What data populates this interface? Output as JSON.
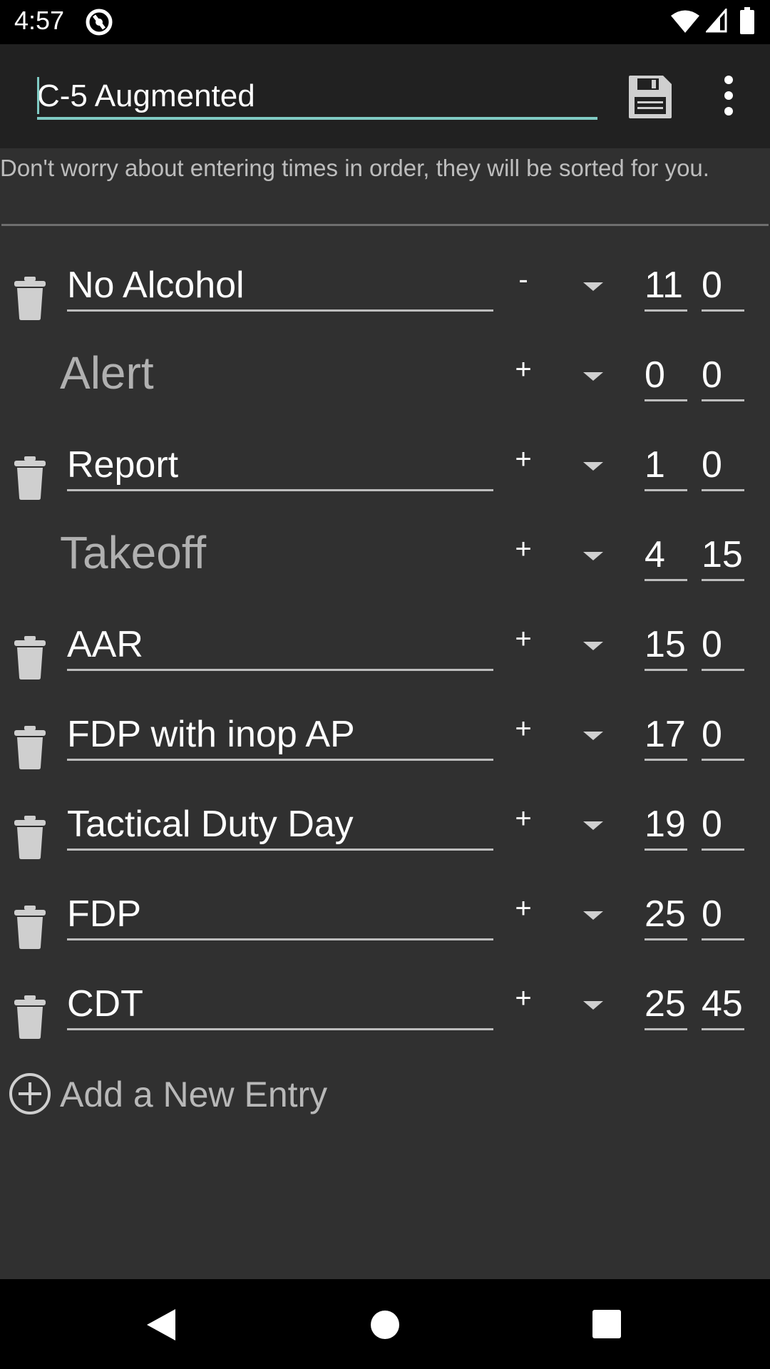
{
  "status_bar": {
    "time": "4:57",
    "icons": [
      "app-notification-icon",
      "wifi-icon",
      "signal-icon",
      "battery-icon"
    ]
  },
  "toolbar": {
    "name_value": "C-5 Augmented",
    "save_icon": "floppy-disk-icon",
    "menu_icon": "more-vert-icon"
  },
  "hint": "Don't worry about entering times in order, they will be sorted for you.",
  "rows": [
    {
      "label": "No Alcohol",
      "sign": "-",
      "hours": "11",
      "minutes": "0"
    },
    {
      "label": "Alert",
      "sign": "+",
      "hours": "0",
      "minutes": "0"
    },
    {
      "label": "Report",
      "sign": "+",
      "hours": "1",
      "minutes": "0"
    },
    {
      "label": "Takeoff",
      "sign": "+",
      "hours": "4",
      "minutes": "15"
    },
    {
      "label": "AAR",
      "sign": "+",
      "hours": "15",
      "minutes": "0"
    },
    {
      "label": "FDP with inop AP",
      "sign": "+",
      "hours": "17",
      "minutes": "0"
    },
    {
      "label": "Tactical Duty Day",
      "sign": "+",
      "hours": "19",
      "minutes": "0"
    },
    {
      "label": "FDP",
      "sign": "+",
      "hours": "25",
      "minutes": "0"
    },
    {
      "label": "CDT",
      "sign": "+",
      "hours": "25",
      "minutes": "45"
    }
  ],
  "add_entry": "Add a New Entry",
  "colors": {
    "accent": "#80cbc4",
    "background": "#303030",
    "toolbar": "#212121"
  }
}
